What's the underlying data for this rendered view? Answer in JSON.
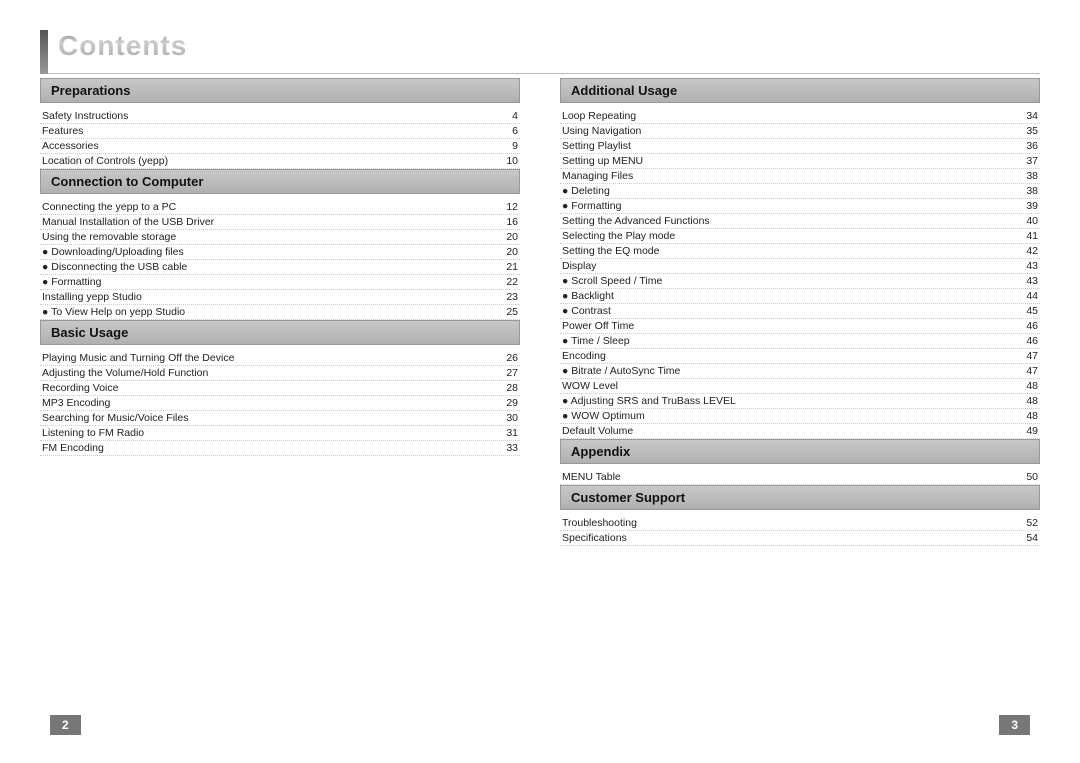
{
  "title": "Contents",
  "page_left": "2",
  "page_right": "3",
  "left_sections": [
    {
      "id": "preparations",
      "header": "Preparations",
      "entries": [
        {
          "label": "Safety Instructions",
          "page": "4"
        },
        {
          "label": "Features",
          "page": "6"
        },
        {
          "label": "Accessories",
          "page": "9"
        },
        {
          "label": "Location of Controls (yepp)",
          "page": "10"
        }
      ]
    },
    {
      "id": "connection",
      "header": "Connection to Computer",
      "entries": [
        {
          "label": "Connecting the yepp to a PC",
          "page": "12"
        },
        {
          "label": "Manual Installation of the USB Driver",
          "page": "16"
        },
        {
          "label": "Using the removable storage",
          "page": "20"
        },
        {
          "label": "● Downloading/Uploading files",
          "page": "20"
        },
        {
          "label": "● Disconnecting the USB cable",
          "page": "21"
        },
        {
          "label": "● Formatting",
          "page": "22"
        },
        {
          "label": "Installing yepp Studio",
          "page": "23"
        },
        {
          "label": "● To View Help on yepp Studio",
          "page": "25"
        }
      ]
    },
    {
      "id": "basic",
      "header": "Basic Usage",
      "entries": [
        {
          "label": "Playing Music and Turning Off the Device",
          "page": "26"
        },
        {
          "label": "Adjusting the Volume/Hold Function",
          "page": "27"
        },
        {
          "label": "Recording Voice",
          "page": "28"
        },
        {
          "label": "MP3 Encoding",
          "page": "29"
        },
        {
          "label": "Searching for Music/Voice Files",
          "page": "30"
        },
        {
          "label": "Listening to FM Radio",
          "page": "31"
        },
        {
          "label": "FM Encoding",
          "page": "33"
        }
      ]
    }
  ],
  "right_sections": [
    {
      "id": "additional",
      "header": "Additional Usage",
      "entries": [
        {
          "label": "Loop Repeating",
          "page": "34"
        },
        {
          "label": "Using Navigation",
          "page": "35"
        },
        {
          "label": "Setting Playlist",
          "page": "36"
        },
        {
          "label": "Setting up MENU",
          "page": "37"
        },
        {
          "label": "Managing Files",
          "page": "38"
        },
        {
          "label": "● Deleting",
          "page": "38"
        },
        {
          "label": "● Formatting",
          "page": "39"
        },
        {
          "label": "Setting the Advanced Functions",
          "page": "40"
        },
        {
          "label": "Selecting the Play mode",
          "page": "41"
        },
        {
          "label": "Setting the EQ mode",
          "page": "42"
        },
        {
          "label": "Display",
          "page": "43"
        },
        {
          "label": "● Scroll Speed / Time",
          "page": "43"
        },
        {
          "label": "● Backlight",
          "page": "44"
        },
        {
          "label": "● Contrast",
          "page": "45"
        },
        {
          "label": "Power Off Time",
          "page": "46"
        },
        {
          "label": "● Time / Sleep",
          "page": "46"
        },
        {
          "label": "Encoding",
          "page": "47"
        },
        {
          "label": "● Bitrate / AutoSync Time",
          "page": "47"
        },
        {
          "label": "WOW Level",
          "page": "48"
        },
        {
          "label": "● Adjusting SRS and TruBass LEVEL",
          "page": "48"
        },
        {
          "label": "● WOW Optimum",
          "page": "48"
        },
        {
          "label": "Default Volume",
          "page": "49"
        }
      ]
    },
    {
      "id": "appendix",
      "header": "Appendix",
      "entries": [
        {
          "label": "MENU Table",
          "page": "50"
        }
      ]
    },
    {
      "id": "customer",
      "header": "Customer Support",
      "entries": [
        {
          "label": "Troubleshooting",
          "page": "52"
        },
        {
          "label": "Specifications",
          "page": "54"
        }
      ]
    }
  ]
}
